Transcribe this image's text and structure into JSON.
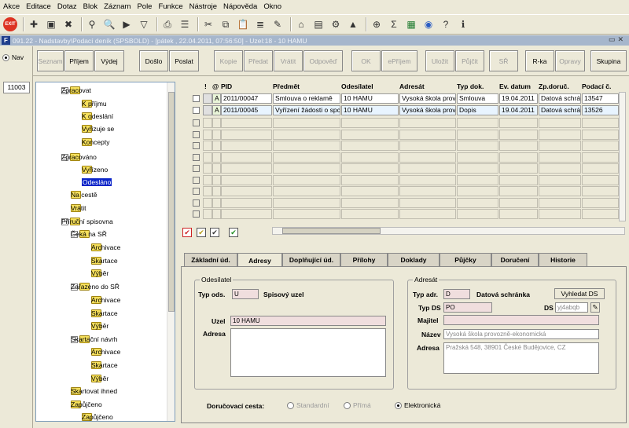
{
  "menu": [
    "Akce",
    "Editace",
    "Dotaz",
    "Blok",
    "Záznam",
    "Pole",
    "Funkce",
    "Nástroje",
    "Nápověda",
    "Okno"
  ],
  "window": {
    "title": "091.22 - Nadstavby\\Podací deník (SPSBOLD) - [pátek , 22.04.2011, 07:56:50] - Uzel:18 - 10 HAMU"
  },
  "left": {
    "nav_label": "Nav",
    "node_id": "11003"
  },
  "actions": {
    "seznam": "Seznam",
    "prijem": "Příjem",
    "vydej": "Výdej",
    "doslo": "Došlo",
    "poslat": "Poslat",
    "kopie": "Kopie",
    "predat": "Předat",
    "vratit": "Vrátit",
    "odpoved": "Odpověď",
    "ok": "OK",
    "eprijem": "ePříjem",
    "ulozit": "Uložit",
    "pujcit": "Půjčit",
    "sr": "SŘ",
    "rka": "R-ka",
    "opravy": "Opravy",
    "skupina": "Skupina"
  },
  "tree": [
    {
      "label": "Zpracovat"
    },
    {
      "label": "K příjmu"
    },
    {
      "label": "K odeslání"
    },
    {
      "label": "Vyřizuje se"
    },
    {
      "label": "Koncepty"
    },
    {
      "label": "Zpracováno"
    },
    {
      "label": "Vyřízeno"
    },
    {
      "label": "Odesláno"
    },
    {
      "label": "Na cestě"
    },
    {
      "label": "Vrátit"
    },
    {
      "label": "Příruční spisovna"
    },
    {
      "label": "Čeká na SŘ"
    },
    {
      "label": "Archivace"
    },
    {
      "label": "Skartace"
    },
    {
      "label": "Výběr"
    },
    {
      "label": "Zařazeno do SŘ"
    },
    {
      "label": "Archivace"
    },
    {
      "label": "Skartace"
    },
    {
      "label": "Výběr"
    },
    {
      "label": "Skartační návrh"
    },
    {
      "label": "Archivace"
    },
    {
      "label": "Skartace"
    },
    {
      "label": "Výběr"
    },
    {
      "label": "Skartovat ihned"
    },
    {
      "label": "Zapůjčeno"
    },
    {
      "label": "Zapůjčeno"
    }
  ],
  "grid": {
    "headers": {
      "excl": "!",
      "clip": "@",
      "pid": "PID",
      "predmet": "Předmět",
      "odesilatel": "Odesílatel",
      "adresat": "Adresát",
      "typ": "Typ dok.",
      "datum": "Ev. datum",
      "zp": "Zp.doruč.",
      "podaci": "Podací č."
    },
    "rows": [
      {
        "flag": "A",
        "pid": "2011/00047",
        "predmet": "Smlouva o reklamě",
        "odesilatel": "10 HAMU",
        "adresat": "Vysoká škola prov",
        "typ": "Smlouva",
        "datum": "19.04.2011",
        "zp": "Datová schrán",
        "podaci": "13547"
      },
      {
        "flag": "A",
        "pid": "2011/00045",
        "predmet": "Vyřízení žádosti o spc",
        "odesilatel": "10 HAMU",
        "adresat": "Vysoká škola prov",
        "typ": "Dopis",
        "datum": "19.04.2011",
        "zp": "Datová schrán",
        "podaci": "13526"
      }
    ]
  },
  "tabs": [
    "Základní úd.",
    "Adresy",
    "Doplňující úd.",
    "Přílohy",
    "Doklady",
    "Půjčky",
    "Doručení",
    "Historie"
  ],
  "odesilatel": {
    "group": "Odesílatel",
    "typ_label": "Typ ods.",
    "typ_value": "U",
    "typ_desc": "Spisový uzel",
    "uzel_label": "Uzel",
    "uzel_value": "10 HAMU",
    "adresa_label": "Adresa"
  },
  "adresat": {
    "group": "Adresát",
    "typ_label": "Typ adr.",
    "typ_value": "D",
    "typ_desc": "Datová schránka",
    "vyhledat": "Vyhledat DS",
    "typds_label": "Typ DS",
    "typds_value": "PO",
    "ds_label": "DS",
    "ds_value": "yj4abqb",
    "majitel_label": "Majitel",
    "nazev_label": "Název",
    "nazev_value": "Vysoká škola provozně-ekonomická",
    "adresa_label": "Adresa",
    "adresa_value": "Pražská 548, 38901 České Budějovice, CZ"
  },
  "delivery": {
    "label": "Doručovací cesta:",
    "opt1": "Standardní",
    "opt2": "Přímá",
    "opt3": "Elektronická",
    "selected": "Elektronická"
  }
}
